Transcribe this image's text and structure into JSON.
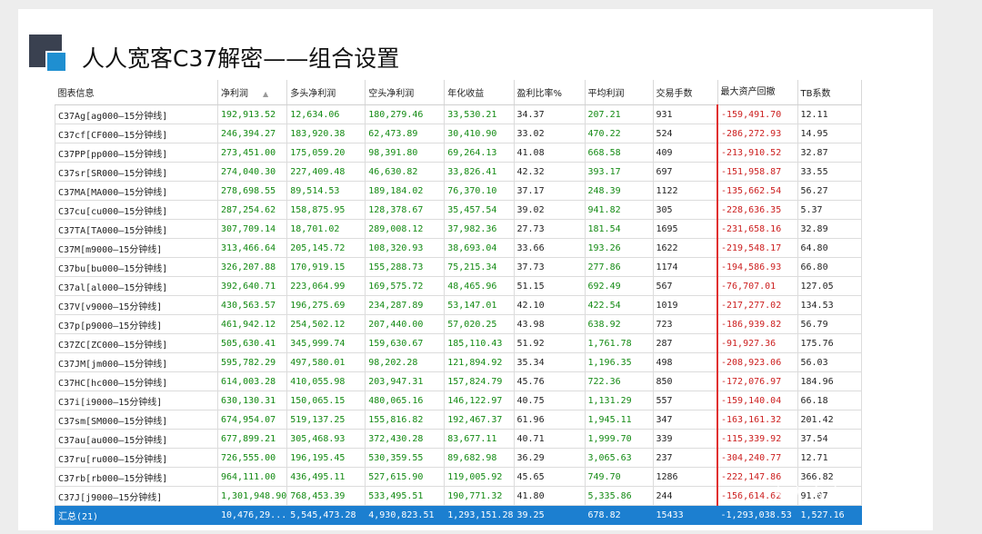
{
  "title": "人人宽客C37解密——组合设置",
  "watermark": "人人宽客",
  "columns": [
    "图表信息",
    "净利润",
    "多头净利润",
    "空头净利润",
    "年化收益",
    "盈利比率%",
    "平均利润",
    "交易手数",
    "最大资产回撤",
    "TB系数"
  ],
  "sort_indicator": "▲",
  "rows": [
    [
      "C37Ag[ag000—15分钟线]",
      "192,913.52",
      "12,634.06",
      "180,279.46",
      "33,530.21",
      "34.37",
      "207.21",
      "931",
      "-159,491.70",
      "12.11"
    ],
    [
      "C37cf[CF000—15分钟线]",
      "246,394.27",
      "183,920.38",
      "62,473.89",
      "30,410.90",
      "33.02",
      "470.22",
      "524",
      "-286,272.93",
      "14.95"
    ],
    [
      "C37PP[pp000—15分钟线]",
      "273,451.00",
      "175,059.20",
      "98,391.80",
      "69,264.13",
      "41.08",
      "668.58",
      "409",
      "-213,910.52",
      "32.87"
    ],
    [
      "C37sr[SR000—15分钟线]",
      "274,040.30",
      "227,409.48",
      "46,630.82",
      "33,826.41",
      "42.32",
      "393.17",
      "697",
      "-151,958.87",
      "33.55"
    ],
    [
      "C37MA[MA000—15分钟线]",
      "278,698.55",
      "89,514.53",
      "189,184.02",
      "76,370.10",
      "37.17",
      "248.39",
      "1122",
      "-135,662.54",
      "56.27"
    ],
    [
      "C37cu[cu000—15分钟线]",
      "287,254.62",
      "158,875.95",
      "128,378.67",
      "35,457.54",
      "39.02",
      "941.82",
      "305",
      "-228,636.35",
      "5.37"
    ],
    [
      "C37TA[TA000—15分钟线]",
      "307,709.14",
      "18,701.02",
      "289,008.12",
      "37,982.36",
      "27.73",
      "181.54",
      "1695",
      "-231,658.16",
      "32.89"
    ],
    [
      "C37M[m9000—15分钟线]",
      "313,466.64",
      "205,145.72",
      "108,320.93",
      "38,693.04",
      "33.66",
      "193.26",
      "1622",
      "-219,548.17",
      "64.80"
    ],
    [
      "C37bu[bu000—15分钟线]",
      "326,207.88",
      "170,919.15",
      "155,288.73",
      "75,215.34",
      "37.73",
      "277.86",
      "1174",
      "-194,586.93",
      "66.80"
    ],
    [
      "C37al[al000—15分钟线]",
      "392,640.71",
      "223,064.99",
      "169,575.72",
      "48,465.96",
      "51.15",
      "692.49",
      "567",
      "-76,707.01",
      "127.05"
    ],
    [
      "C37V[v9000—15分钟线]",
      "430,563.57",
      "196,275.69",
      "234,287.89",
      "53,147.01",
      "42.10",
      "422.54",
      "1019",
      "-217,277.02",
      "134.53"
    ],
    [
      "C37p[p9000—15分钟线]",
      "461,942.12",
      "254,502.12",
      "207,440.00",
      "57,020.25",
      "43.98",
      "638.92",
      "723",
      "-186,939.82",
      "56.79"
    ],
    [
      "C37ZC[ZC000—15分钟线]",
      "505,630.41",
      "345,999.74",
      "159,630.67",
      "185,110.43",
      "51.92",
      "1,761.78",
      "287",
      "-91,927.36",
      "175.76"
    ],
    [
      "C37JM[jm000—15分钟线]",
      "595,782.29",
      "497,580.01",
      "98,202.28",
      "121,894.92",
      "35.34",
      "1,196.35",
      "498",
      "-208,923.06",
      "56.03"
    ],
    [
      "C37HC[hc000—15分钟线]",
      "614,003.28",
      "410,055.98",
      "203,947.31",
      "157,824.79",
      "45.76",
      "722.36",
      "850",
      "-172,076.97",
      "184.96"
    ],
    [
      "C37i[i9000—15分钟线]",
      "630,130.31",
      "150,065.15",
      "480,065.16",
      "146,122.97",
      "40.75",
      "1,131.29",
      "557",
      "-159,140.04",
      "66.18"
    ],
    [
      "C37sm[SM000—15分钟线]",
      "674,954.07",
      "519,137.25",
      "155,816.82",
      "192,467.37",
      "61.96",
      "1,945.11",
      "347",
      "-163,161.32",
      "201.42"
    ],
    [
      "C37au[au000—15分钟线]",
      "677,899.21",
      "305,468.93",
      "372,430.28",
      "83,677.11",
      "40.71",
      "1,999.70",
      "339",
      "-115,339.92",
      "37.54"
    ],
    [
      "C37ru[ru000—15分钟线]",
      "726,555.00",
      "196,195.45",
      "530,359.55",
      "89,682.98",
      "36.29",
      "3,065.63",
      "237",
      "-304,240.77",
      "12.71"
    ],
    [
      "C37rb[rb000—15分钟线]",
      "964,111.00",
      "436,495.11",
      "527,615.90",
      "119,005.92",
      "45.65",
      "749.70",
      "1286",
      "-222,147.86",
      "366.82"
    ],
    [
      "C37J[j9000—15分钟线]",
      "1,301,948.90",
      "768,453.39",
      "533,495.51",
      "190,771.32",
      "41.80",
      "5,335.86",
      "244",
      "-156,614.62",
      "91.07"
    ]
  ],
  "total": [
    "汇总(21)",
    "10,476,29...",
    "5,545,473.28",
    "4,930,823.51",
    "1,293,151.28",
    "39.25",
    "678.82",
    "15433",
    "-1,293,038.53",
    "1,527.16"
  ]
}
